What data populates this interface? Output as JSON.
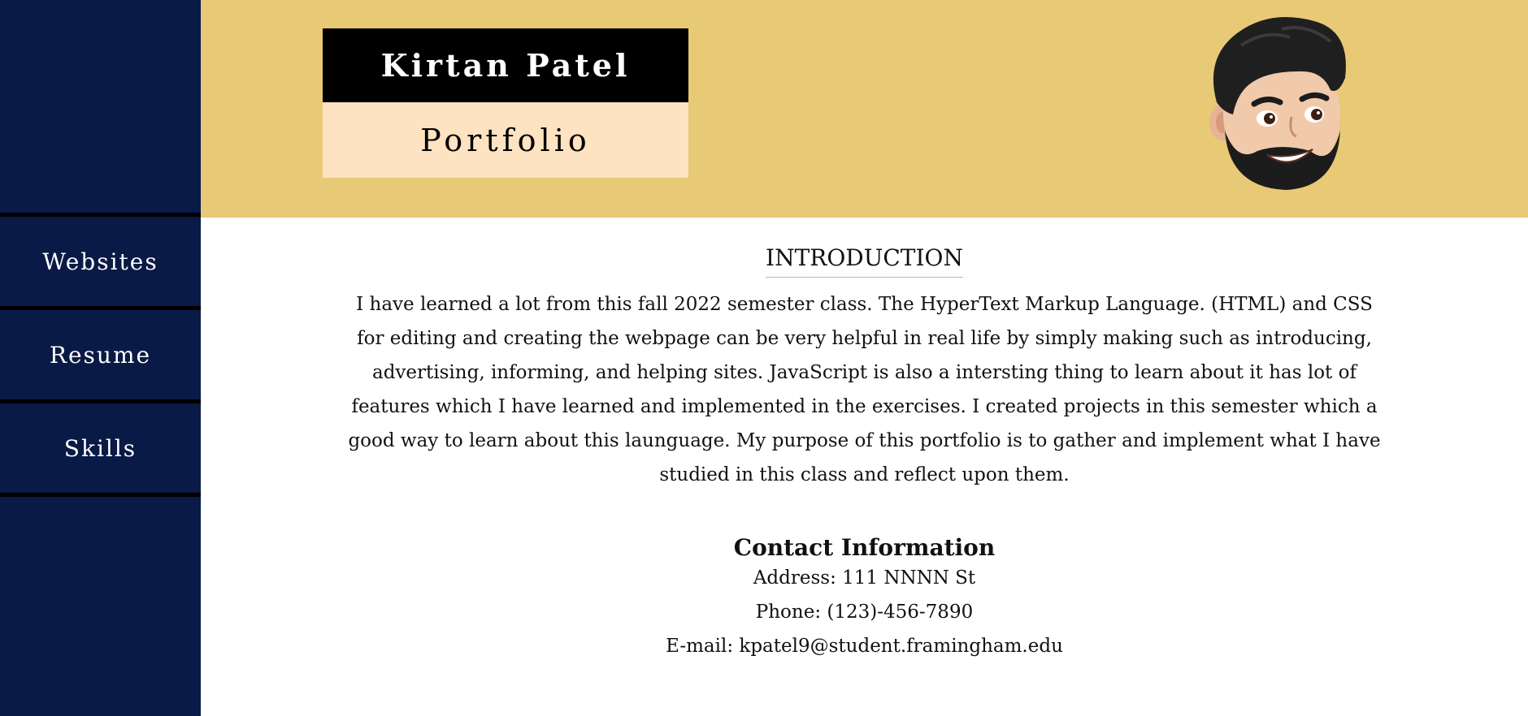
{
  "header": {
    "name": "Kirtan Patel",
    "subtitle": "Portfolio",
    "avatar_icon": "memoji-avatar-icon",
    "background_color": "#e8c976"
  },
  "sidebar": {
    "background_color": "#0a1a46",
    "items": [
      {
        "label": "Websites"
      },
      {
        "label": "Resume"
      },
      {
        "label": "Skills"
      }
    ]
  },
  "main": {
    "section_title": "INTRODUCTION",
    "intro_text": "I have learned a lot from this fall 2022 semester class. The HyperText Markup Language. (HTML) and CSS for editing and creating the webpage can be very helpful in real life by simply making such as introducing, advertising, informing, and helping sites. JavaScript is also a intersting thing to learn about it has lot of features which I have learned and implemented in the exercises. I created projects in this semester which a good way to learn about this launguage. My purpose of this portfolio is to gather and implement what I have studied in this class and reflect upon them.",
    "contact": {
      "title": "Contact Information",
      "address": "Address: 111 NNNN St",
      "phone": "Phone: (123)-456-7890",
      "email": "E-mail: kpatel9@student.framingham.edu"
    }
  }
}
